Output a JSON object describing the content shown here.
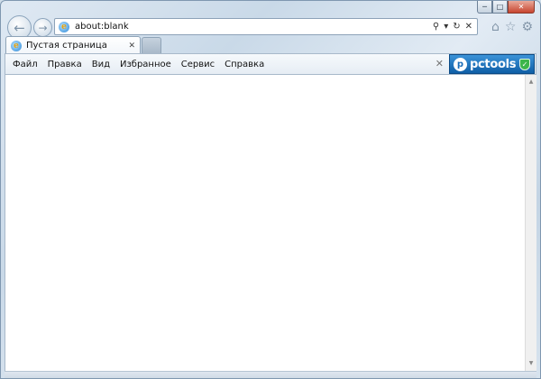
{
  "window": {
    "caption": {
      "minimize": "─",
      "maximize": "□",
      "close": "✕"
    }
  },
  "nav": {
    "back_icon": "back-arrow-icon",
    "forward_icon": "forward-arrow-icon"
  },
  "address_bar": {
    "url": "about:blank",
    "tools": {
      "search": "⚲",
      "dropdown": "▾",
      "refresh": "↻",
      "stop": "✕"
    }
  },
  "toolbar_icons": {
    "home": "⌂",
    "favorites": "☆",
    "settings": "⚙"
  },
  "tabs": [
    {
      "title": "Пустая страница",
      "close": "✕",
      "active": true
    }
  ],
  "menu": {
    "items": [
      "Файл",
      "Правка",
      "Вид",
      "Избранное",
      "Сервис",
      "Справка"
    ],
    "close": "✕"
  },
  "pctools": {
    "brand": "pctools",
    "logo_letter": "p",
    "shield": "✓"
  },
  "scrollbar": {
    "up": "▲",
    "down": "▼"
  },
  "colors": {
    "accent": "#1a6db8",
    "close_button": "#c7452f",
    "pctools_bg": "#0f5ea6"
  }
}
